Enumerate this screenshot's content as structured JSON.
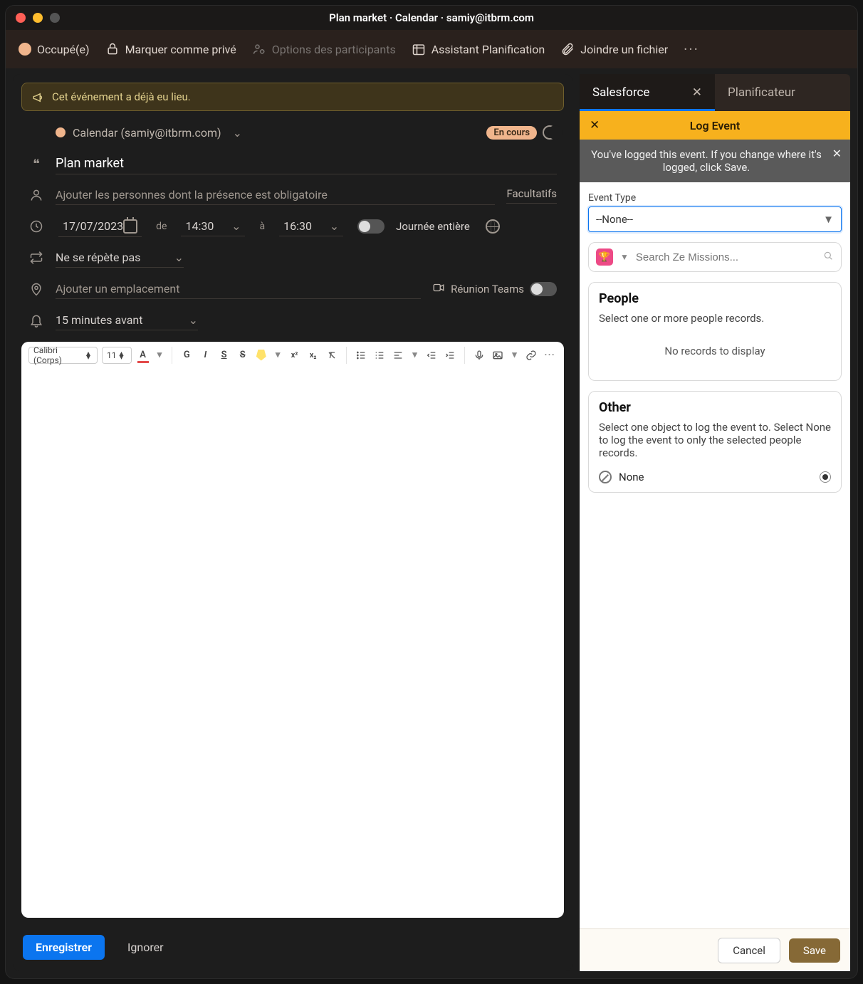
{
  "window_title": "Plan market · Calendar · samiy@itbrm.com",
  "toolbar": {
    "status": "Occupé(e)",
    "private": "Marquer comme privé",
    "participants": "Options des participants",
    "scheduling": "Assistant Planification",
    "attach": "Joindre un fichier"
  },
  "banner": "Cet événement a déjà eu lieu.",
  "event": {
    "calendar": "Calendar (samiy@itbrm.com)",
    "status_pill": "En cours",
    "title": "Plan market",
    "attendees_placeholder": "Ajouter les personnes dont la présence est obligatoire",
    "optional": "Facultatifs",
    "date": "17/07/2023",
    "from_label": "de",
    "from_time": "14:30",
    "to_label": "à",
    "to_time": "16:30",
    "all_day": "Journée entière",
    "repeat": "Ne se répète pas",
    "location_placeholder": "Ajouter un emplacement",
    "teams": "Réunion Teams",
    "reminder": "15 minutes avant"
  },
  "editor": {
    "font": "Calibri (Corps)",
    "size": "11"
  },
  "footer": {
    "save": "Enregistrer",
    "discard": "Ignorer"
  },
  "side": {
    "tab_sf": "Salesforce",
    "tab_plan": "Planificateur",
    "header": "Log Event",
    "notice": "You've logged this event. If you change where it's logged, click Save.",
    "event_type_label": "Event Type",
    "event_type_value": "--None--",
    "search_placeholder": "Search Ze Missions...",
    "people_title": "People",
    "people_sub": "Select one or more people records.",
    "people_empty": "No records to display",
    "other_title": "Other",
    "other_sub": "Select one object to log the event to. Select None to log the event to only the selected people records.",
    "other_none": "None",
    "cancel": "Cancel",
    "save": "Save"
  }
}
